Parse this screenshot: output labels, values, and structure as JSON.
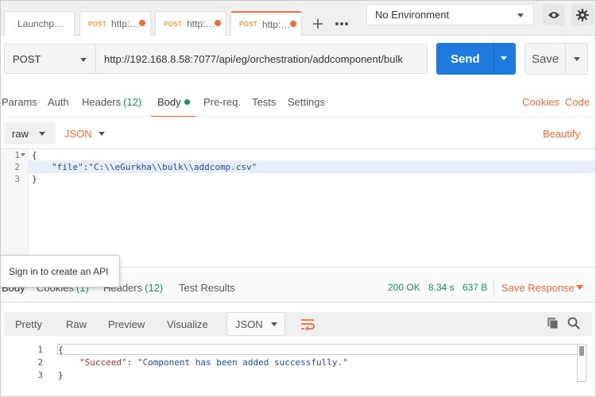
{
  "tabs": [
    {
      "label": "Launchp…",
      "method": ""
    },
    {
      "label": "http:…",
      "method": "POST"
    },
    {
      "label": "http:…",
      "method": "POST"
    },
    {
      "label": "http:…",
      "method": "POST"
    }
  ],
  "environment": {
    "selected": "No Environment"
  },
  "request": {
    "method": "POST",
    "url": "http://192.168.8.58:7077/api/eg/orchestration/addcomponent/bulk",
    "send_label": "Send",
    "save_label": "Save"
  },
  "request_tabs": {
    "params": "Params",
    "auth": "Auth",
    "headers": "Headers",
    "headers_count": "(12)",
    "body": "Body",
    "prereq": "Pre-req.",
    "tests": "Tests",
    "settings": "Settings",
    "cookies": "Cookies",
    "code": "Code"
  },
  "body_bar": {
    "mode": "raw",
    "language": "JSON",
    "beautify": "Beautify"
  },
  "editor": {
    "line_numbers": [
      "1",
      "2",
      "3"
    ],
    "line1": "{",
    "line2_key": "\"file\"",
    "line2_colon": ":",
    "line2_value": "\"C:\\\\eGurkha\\\\bulk\\\\addcomp.csv\"",
    "line3": "}"
  },
  "tooltip": {
    "text": "Sign in to create an API"
  },
  "response_tabs": {
    "body": "Body",
    "cookies": "Cookies",
    "cookies_count": "(1)",
    "headers": "Headers",
    "headers_count": "(12)",
    "test_results": "Test Results"
  },
  "response_status": {
    "status": "200 OK",
    "time": "8.34 s",
    "size": "637 B",
    "save_response": "Save Response"
  },
  "response_toolbar": {
    "pretty": "Pretty",
    "raw": "Raw",
    "preview": "Preview",
    "visualize": "Visualize",
    "format": "JSON"
  },
  "response_body": {
    "line_numbers": [
      "1",
      "2",
      "3"
    ],
    "line1": "{",
    "line2_key": "\"Succeed\"",
    "line2_colon": ": ",
    "line2_value": "\"Component has been added successfully.\"",
    "line3": "}"
  },
  "colors": {
    "accent": "#f26b3a",
    "send_blue": "#1e7bdd",
    "success_green": "#17915c"
  }
}
